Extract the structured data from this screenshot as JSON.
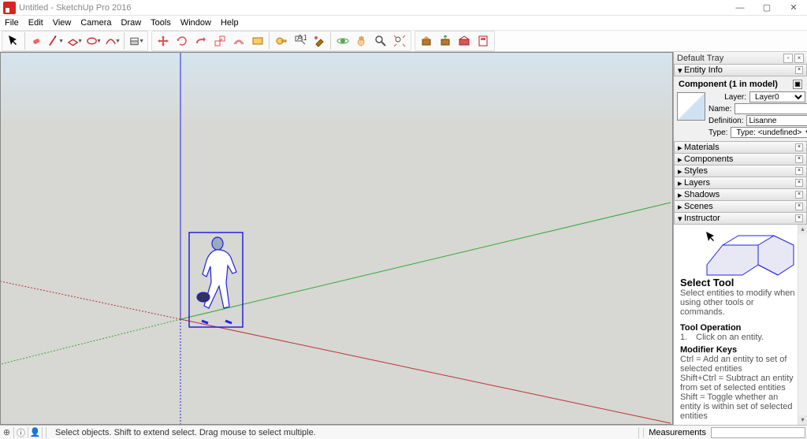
{
  "window": {
    "title": "Untitled - SketchUp Pro 2016",
    "controls": {
      "min": "—",
      "max": "▢",
      "close": "✕"
    }
  },
  "menu": {
    "items": [
      "File",
      "Edit",
      "View",
      "Camera",
      "Draw",
      "Tools",
      "Window",
      "Help"
    ]
  },
  "toolbar_icons": {
    "a": [
      "select",
      "eraser",
      "pencil",
      "rect",
      "circle",
      "arc",
      "pushpull"
    ],
    "b": [
      "move",
      "rotate",
      "scale",
      "offset",
      "orbit",
      "pan",
      "zoom",
      "tapemeasure",
      "text",
      "paint",
      "axes"
    ],
    "c": [
      "walk",
      "look",
      "section",
      "zoomext",
      "addloc",
      "preview",
      "3dwh",
      "extwh",
      "layouts"
    ]
  },
  "tray": {
    "title": "Default Tray",
    "entity_info": {
      "head": "Entity Info",
      "heading": "Component (1 in model)",
      "layer_label": "Layer:",
      "layer_value": "Layer0",
      "name_label": "Name:",
      "name_value": "",
      "def_label": "Definition:",
      "def_value": "Lisanne",
      "type_label": "Type:",
      "type_value": "Type: <undefined>"
    },
    "sections": [
      "Materials",
      "Components",
      "Styles",
      "Layers",
      "Shadows",
      "Scenes"
    ],
    "instructor": {
      "head": "Instructor",
      "title": "Select Tool",
      "desc": "Select entities to modify when using other tools or commands.",
      "op_head": "Tool Operation",
      "op_1": "1. Click on an entity.",
      "mk_head": "Modifier Keys",
      "mk_1": "Ctrl = Add an entity to set of selected entities",
      "mk_2": "Shift+Ctrl = Subtract an entity from set of selected entities",
      "mk_3": "Shift = Toggle whether an entity is within set of selected entities"
    }
  },
  "status": {
    "hint": "Select objects. Shift to extend select. Drag mouse to select multiple.",
    "measurements_label": "Measurements"
  }
}
